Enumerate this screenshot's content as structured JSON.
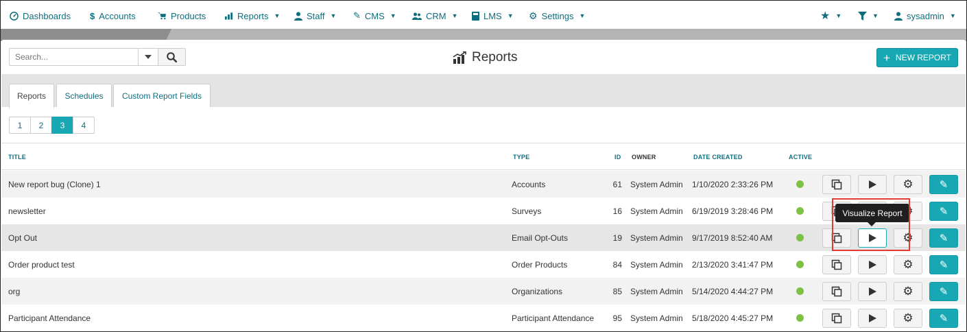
{
  "nav": {
    "items": [
      {
        "label": "Dashboards",
        "icon": "dashboard-icon",
        "dropdown": false
      },
      {
        "label": "Accounts",
        "icon": "dollar-icon",
        "dropdown": false
      },
      {
        "label": "Products",
        "icon": "cart-icon",
        "dropdown": false
      },
      {
        "label": "Reports",
        "icon": "chart-icon",
        "dropdown": true
      },
      {
        "label": "Staff",
        "icon": "person-icon",
        "dropdown": true
      },
      {
        "label": "CMS",
        "icon": "pencil-icon",
        "dropdown": true
      },
      {
        "label": "CRM",
        "icon": "group-icon",
        "dropdown": true
      },
      {
        "label": "LMS",
        "icon": "book-icon",
        "dropdown": true
      },
      {
        "label": "Settings",
        "icon": "gear-icon",
        "dropdown": true
      }
    ],
    "user": "sysadmin"
  },
  "search": {
    "placeholder": "Search..."
  },
  "page_title": "Reports",
  "new_report_label": "NEW REPORT",
  "tabs": [
    {
      "label": "Reports",
      "active": true
    },
    {
      "label": "Schedules",
      "active": false
    },
    {
      "label": "Custom Report Fields",
      "active": false
    }
  ],
  "pagination": {
    "pages": [
      "1",
      "2",
      "3",
      "4"
    ],
    "current": "3"
  },
  "table": {
    "columns": {
      "title": "TITLE",
      "type": "TYPE",
      "id": "ID",
      "owner": "OWNER",
      "date": "DATE CREATED",
      "active": "ACTIVE"
    },
    "rows": [
      {
        "title": "New report bug (Clone) 1",
        "type": "Accounts",
        "id": "61",
        "owner": "System Admin",
        "date": "1/10/2020 2:33:26 PM",
        "active": true
      },
      {
        "title": "newsletter",
        "type": "Surveys",
        "id": "16",
        "owner": "System Admin",
        "date": "6/19/2019 3:28:46 PM",
        "active": true
      },
      {
        "title": "Opt Out",
        "type": "Email Opt-Outs",
        "id": "19",
        "owner": "System Admin",
        "date": "9/17/2019 8:52:40 AM",
        "active": true
      },
      {
        "title": "Order product test",
        "type": "Order Products",
        "id": "84",
        "owner": "System Admin",
        "date": "2/13/2020 3:41:47 PM",
        "active": true
      },
      {
        "title": "org",
        "type": "Organizations",
        "id": "85",
        "owner": "System Admin",
        "date": "5/14/2020 4:44:27 PM",
        "active": true
      },
      {
        "title": "Participant Attendance",
        "type": "Participant Attendance",
        "id": "95",
        "owner": "System Admin",
        "date": "5/18/2020 4:45:27 PM",
        "active": true
      }
    ]
  },
  "tooltip": "Visualize Report",
  "colors": {
    "accent": "#17a8b4",
    "nav_text": "#0f6e7e",
    "active_dot": "#7dc242",
    "highlight": "#e53935"
  }
}
